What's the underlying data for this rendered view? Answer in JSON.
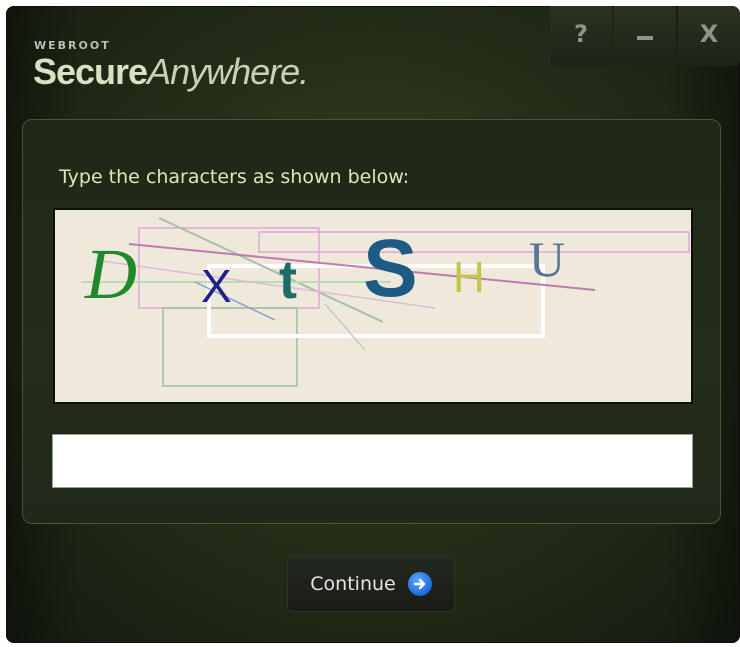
{
  "app": {
    "brand_small": "WEBROOT",
    "brand_main_bold": "Secure",
    "brand_main_light": "Anywhere",
    "brand_suffix": "."
  },
  "window_controls": {
    "help_label": "?",
    "close_label": "X"
  },
  "form": {
    "prompt": "Type the characters as shown below:",
    "captcha": {
      "characters": [
        "D",
        "X",
        "t",
        "S",
        "H",
        "U"
      ]
    },
    "input_value": "",
    "continue_label": "Continue"
  },
  "icons": {
    "continue_icon": "arrow-right-circle-icon",
    "minimize_icon": "minimize-icon",
    "help_icon": "help-icon",
    "close_icon": "close-icon"
  },
  "colors": {
    "accent_blue": "#1e6ad8",
    "prompt_text": "#dfe6b8",
    "captcha_bg": "#efe9dc"
  }
}
